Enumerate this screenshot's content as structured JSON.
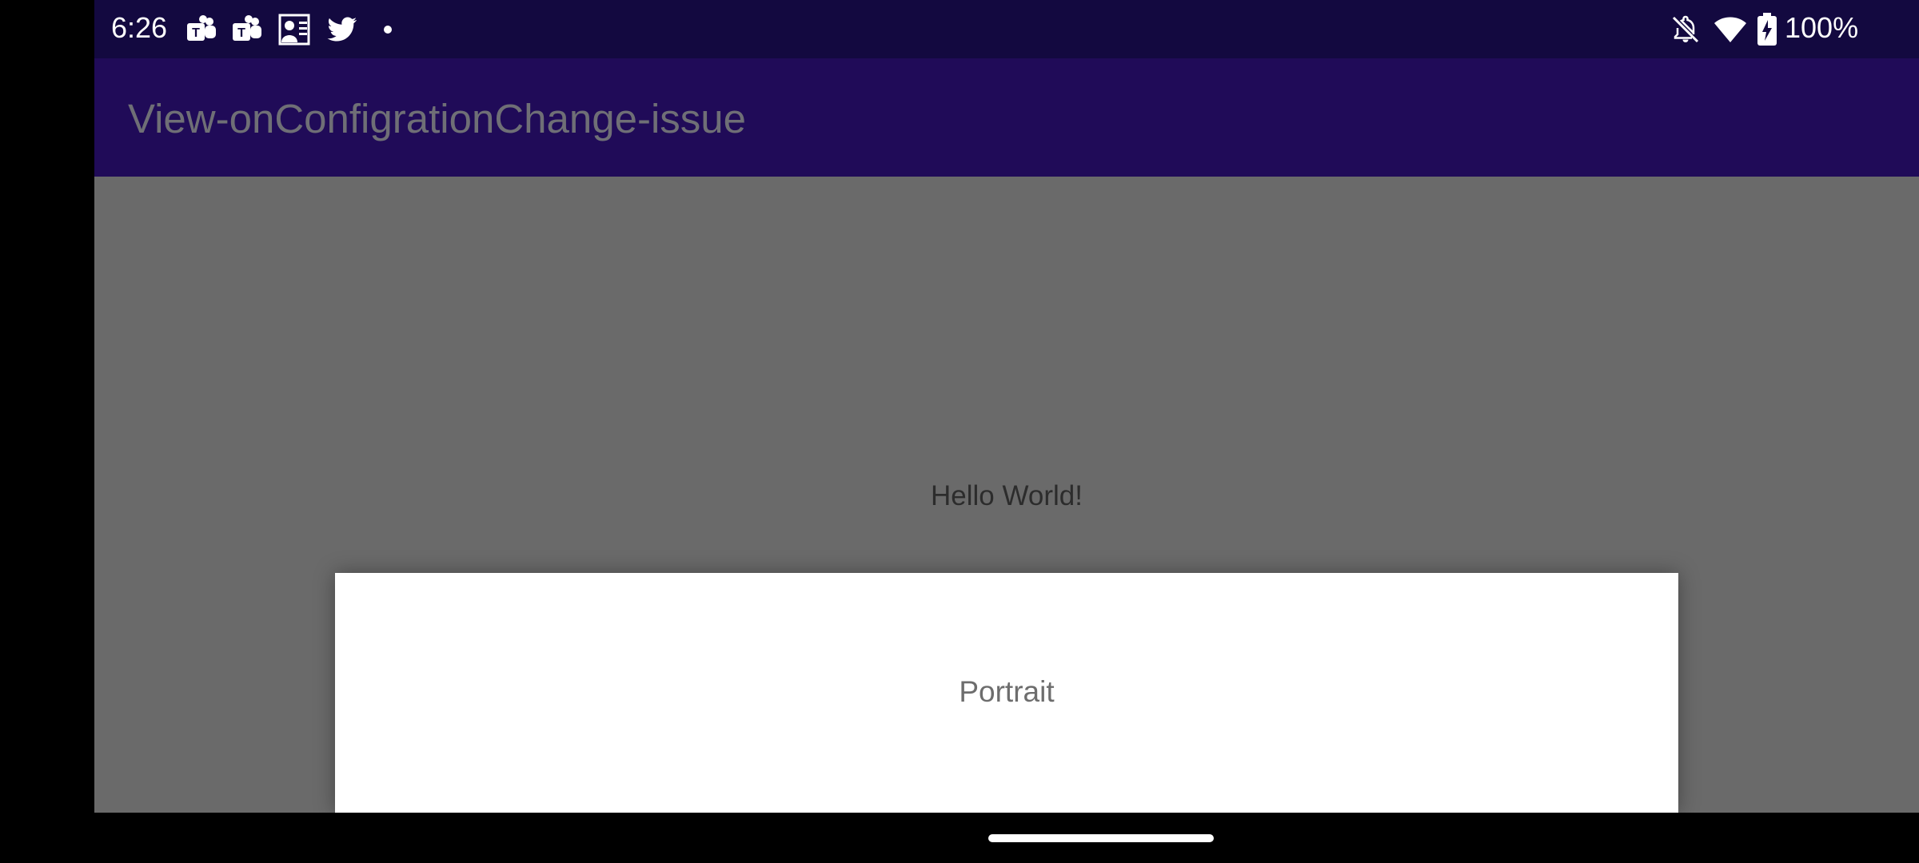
{
  "status_bar": {
    "time": "6:26",
    "notification_icons": [
      "teams-icon",
      "teams-icon",
      "contacts-board-icon",
      "twitter-icon",
      "more-dot-icon"
    ],
    "right_icons": [
      "notifications-off-icon",
      "wifi-icon",
      "battery-charging-icon"
    ],
    "battery": "100%",
    "background_color": "#130940"
  },
  "app_bar": {
    "title": "View-onConfigrationChange-issue",
    "background_color": "#200b58"
  },
  "main": {
    "hello_text": "Hello World!",
    "scrim_color": "#6a6a6a"
  },
  "dialog": {
    "message": "Portrait"
  },
  "nav_bar": {
    "handle": "gesture-handle"
  }
}
